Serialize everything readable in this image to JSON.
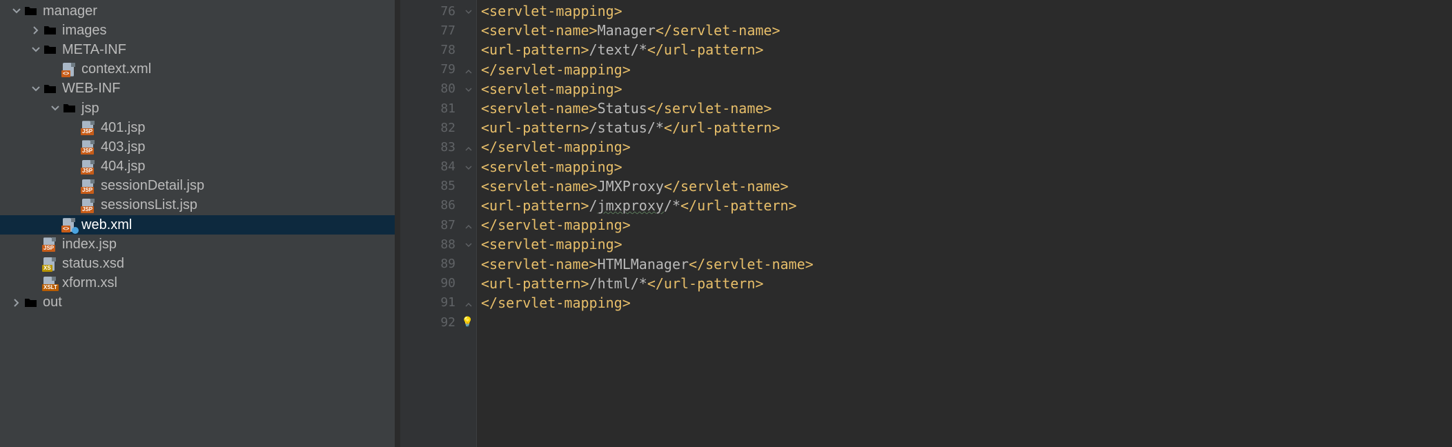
{
  "tree": {
    "items": [
      {
        "depth": 0,
        "chevron": "down",
        "icon": "folder-open",
        "name": "manager"
      },
      {
        "depth": 1,
        "chevron": "right",
        "icon": "folder-closed",
        "name": "images"
      },
      {
        "depth": 1,
        "chevron": "down",
        "icon": "folder-open",
        "name": "META-INF"
      },
      {
        "depth": 2,
        "chevron": "",
        "icon": "xml",
        "name": "context.xml"
      },
      {
        "depth": 1,
        "chevron": "down",
        "icon": "folder-open",
        "name": "WEB-INF"
      },
      {
        "depth": 2,
        "chevron": "down",
        "icon": "folder-open",
        "name": "jsp"
      },
      {
        "depth": 3,
        "chevron": "",
        "icon": "jsp",
        "name": "401.jsp"
      },
      {
        "depth": 3,
        "chevron": "",
        "icon": "jsp",
        "name": "403.jsp"
      },
      {
        "depth": 3,
        "chevron": "",
        "icon": "jsp",
        "name": "404.jsp"
      },
      {
        "depth": 3,
        "chevron": "",
        "icon": "jsp",
        "name": "sessionDetail.jsp"
      },
      {
        "depth": 3,
        "chevron": "",
        "icon": "jsp",
        "name": "sessionsList.jsp"
      },
      {
        "depth": 2,
        "chevron": "",
        "icon": "xml-conf",
        "name": "web.xml",
        "selected": true
      },
      {
        "depth": 1,
        "chevron": "",
        "icon": "jsp",
        "name": "index.jsp"
      },
      {
        "depth": 1,
        "chevron": "",
        "icon": "xsd",
        "name": "status.xsd"
      },
      {
        "depth": 1,
        "chevron": "",
        "icon": "xslt",
        "name": "xform.xsl"
      },
      {
        "depth": 0,
        "chevron": "right",
        "icon": "folder-out",
        "name": "out"
      }
    ]
  },
  "editor": {
    "line_start": 76,
    "lines": [
      {
        "indent": 1,
        "fold": "start",
        "parts": [
          {
            "t": "tag",
            "s": "<servlet-mapping>"
          }
        ]
      },
      {
        "indent": 2,
        "parts": [
          {
            "t": "tag",
            "s": "<servlet-name>"
          },
          {
            "t": "txt",
            "s": "Manager"
          },
          {
            "t": "tag",
            "s": "</servlet-name>"
          }
        ]
      },
      {
        "indent": 3,
        "parts": [
          {
            "t": "tag",
            "s": "<url-pattern>"
          },
          {
            "t": "txt",
            "s": "/text/*"
          },
          {
            "t": "tag",
            "s": "</url-pattern>"
          }
        ]
      },
      {
        "indent": 1,
        "fold": "end",
        "parts": [
          {
            "t": "tag",
            "s": "</servlet-mapping>"
          }
        ]
      },
      {
        "indent": 1,
        "fold": "start",
        "parts": [
          {
            "t": "tag",
            "s": "<servlet-mapping>"
          }
        ]
      },
      {
        "indent": 2,
        "parts": [
          {
            "t": "tag",
            "s": "<servlet-name>"
          },
          {
            "t": "txt",
            "s": "Status"
          },
          {
            "t": "tag",
            "s": "</servlet-name>"
          }
        ]
      },
      {
        "indent": 2,
        "parts": [
          {
            "t": "tag",
            "s": "<url-pattern>"
          },
          {
            "t": "txt",
            "s": "/status/*"
          },
          {
            "t": "tag",
            "s": "</url-pattern>"
          }
        ]
      },
      {
        "indent": 1,
        "fold": "end",
        "parts": [
          {
            "t": "tag",
            "s": "</servlet-mapping>"
          }
        ]
      },
      {
        "indent": 1,
        "fold": "start",
        "parts": [
          {
            "t": "tag",
            "s": "<servlet-mapping>"
          }
        ]
      },
      {
        "indent": 2,
        "parts": [
          {
            "t": "tag",
            "s": "<servlet-name>"
          },
          {
            "t": "txt",
            "s": "JMXProxy"
          },
          {
            "t": "tag",
            "s": "</servlet-name>"
          }
        ]
      },
      {
        "indent": 3,
        "parts": [
          {
            "t": "tag",
            "s": "<url-pattern>"
          },
          {
            "t": "txt",
            "s": "/"
          },
          {
            "t": "txt",
            "s": "jmxproxy",
            "wavy": true
          },
          {
            "t": "txt",
            "s": "/*"
          },
          {
            "t": "tag",
            "s": "</url-pattern>"
          }
        ]
      },
      {
        "indent": 1,
        "fold": "end",
        "parts": [
          {
            "t": "tag",
            "s": "</servlet-mapping>"
          }
        ]
      },
      {
        "indent": 1,
        "fold": "start",
        "parts": [
          {
            "t": "tag",
            "s": "<servlet-mapping>"
          }
        ]
      },
      {
        "indent": 2,
        "parts": [
          {
            "t": "tag",
            "s": "<servlet-name>"
          },
          {
            "t": "txt",
            "s": "HTMLManager"
          },
          {
            "t": "tag",
            "s": "</servlet-name>"
          }
        ]
      },
      {
        "indent": 2,
        "parts": [
          {
            "t": "tag",
            "s": "<url-pattern>"
          },
          {
            "t": "txt",
            "s": "/html/*"
          },
          {
            "t": "tag",
            "s": "</url-pattern>"
          }
        ]
      },
      {
        "indent": 1,
        "fold": "end",
        "parts": [
          {
            "t": "tag",
            "s": "</servlet-mapping>"
          }
        ]
      },
      {
        "indent": 0,
        "bulb": true,
        "parts": []
      }
    ]
  }
}
